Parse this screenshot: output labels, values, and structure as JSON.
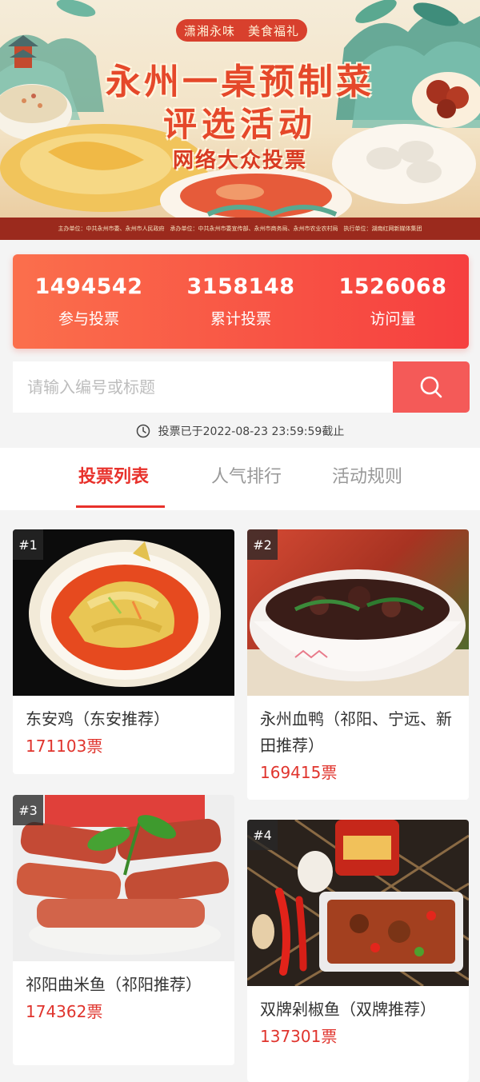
{
  "banner": {
    "slogan": "潇湘永味　美食福礼",
    "title_line1": "永州一桌预制菜",
    "title_line2": "评选活动",
    "subtitle": "网络大众投票",
    "organizers": "主办单位：中共永州市委、永州市人民政府　承办单位：中共永州市委宣传部、永州市商务局、永州市农业农村局　执行单位：湖南红网新媒体集团"
  },
  "stats": [
    {
      "value": "1494542",
      "label": "参与投票"
    },
    {
      "value": "3158148",
      "label": "累计投票"
    },
    {
      "value": "1526068",
      "label": "访问量"
    }
  ],
  "search": {
    "placeholder": "请输入编号或标题"
  },
  "deadline": "投票已于2022-08-23 23:59:59截止",
  "tabs": [
    {
      "label": "投票列表",
      "active": true
    },
    {
      "label": "人气排行",
      "active": false
    },
    {
      "label": "活动规则",
      "active": false
    }
  ],
  "entries": [
    {
      "rank": "#1",
      "title": "东安鸡（东安推荐）",
      "votes": "171103票"
    },
    {
      "rank": "#2",
      "title": "永州血鸭（祁阳、宁远、新田推荐）",
      "votes": "169415票"
    },
    {
      "rank": "#3",
      "title": "祁阳曲米鱼（祁阳推荐）",
      "votes": "174362票"
    },
    {
      "rank": "#4",
      "title": "双牌剁椒鱼（双牌推荐）",
      "votes": "137301票"
    }
  ],
  "colors": {
    "accent": "#e8312b",
    "stats_gradient_start": "#fb6f4c",
    "stats_gradient_end": "#f63f3f",
    "search_button": "#f45a58"
  }
}
